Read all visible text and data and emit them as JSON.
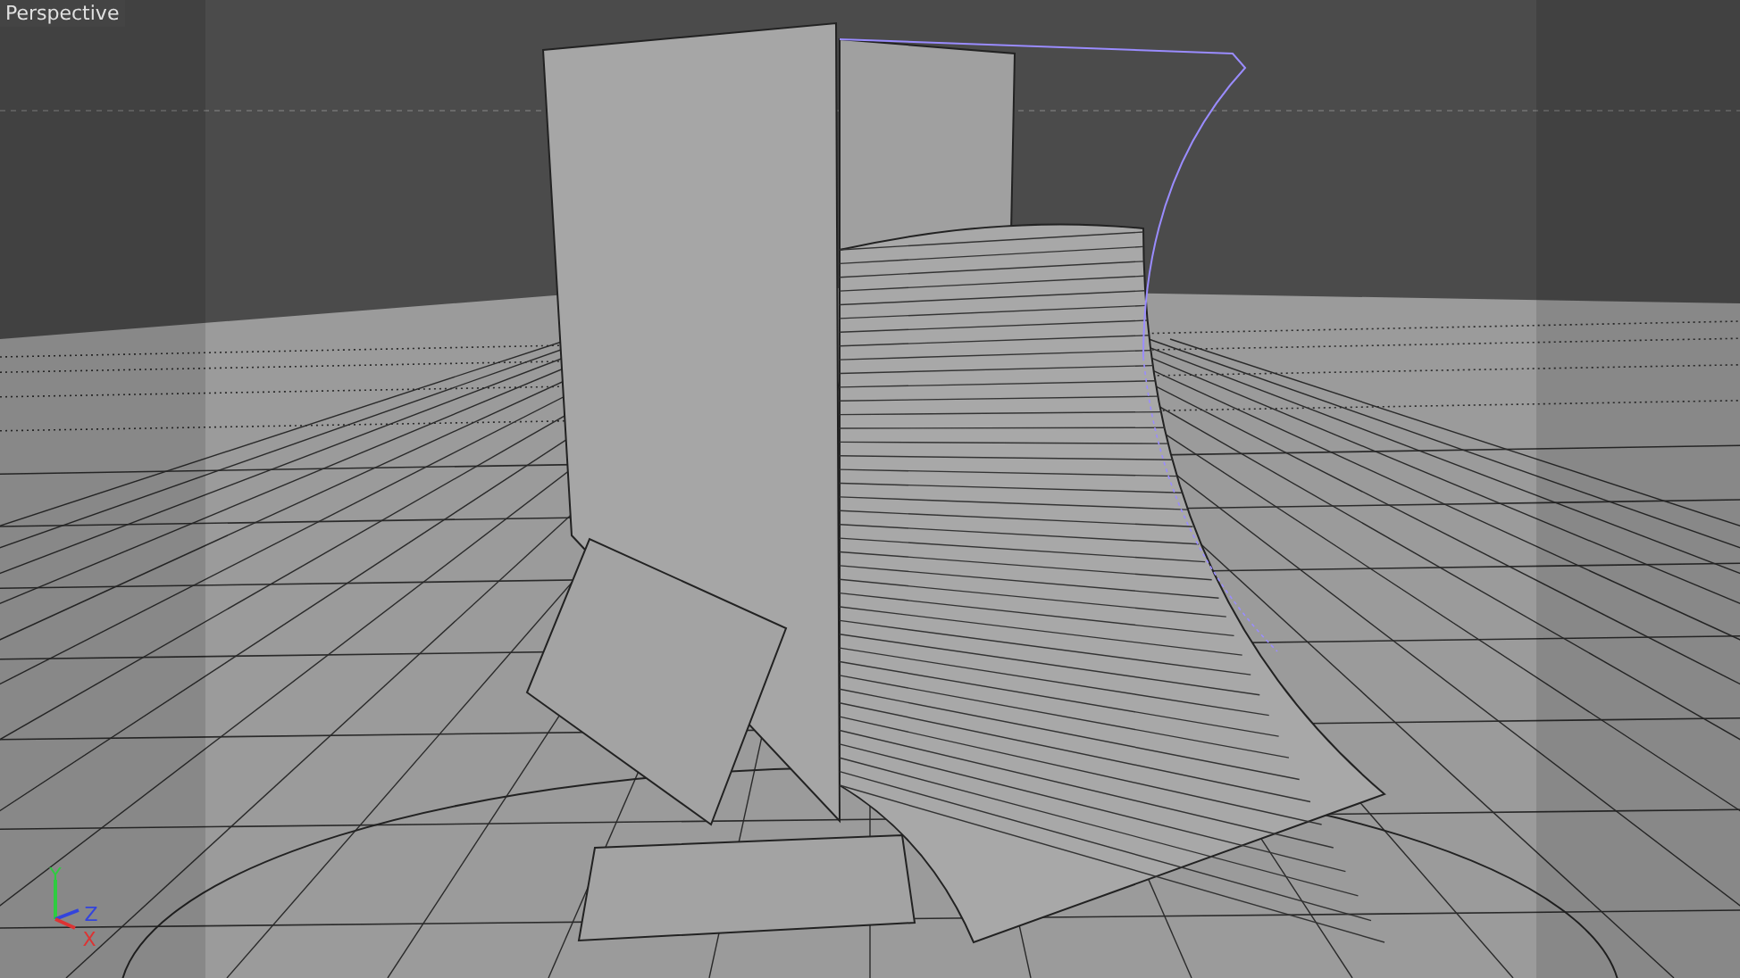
{
  "viewport": {
    "title": "Perspective"
  },
  "axis_gizmo": {
    "axes": [
      {
        "label": "Y",
        "kind": "y",
        "color": "#2ecc40"
      },
      {
        "label": "Z",
        "kind": "z",
        "color": "#3344dd"
      },
      {
        "label": "X",
        "kind": "x",
        "color": "#dd3333"
      }
    ]
  }
}
